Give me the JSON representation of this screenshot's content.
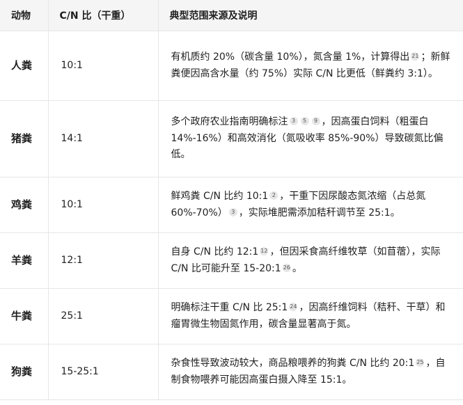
{
  "table": {
    "headers": [
      "动物",
      "C/N 比（干重）",
      "典型范围来源及说明"
    ],
    "rows": [
      {
        "animal": "人粪",
        "ratio": "10:1",
        "desc": [
          {
            "t": "有机质约 20%（碳含量 10%），氮含量 1%，计算得出"
          },
          {
            "c": "21"
          },
          {
            "t": "；新鲜粪便因高含水量（约 75%）实际 C/N 比更低（鲜粪约 3:1）。"
          }
        ]
      },
      {
        "animal": "猪粪",
        "ratio": "14:1",
        "desc": [
          {
            "t": "多个政府农业指南明确标注"
          },
          {
            "c": "3"
          },
          {
            "c": "5"
          },
          {
            "c": "9"
          },
          {
            "t": "，因高蛋白饲料（粗蛋白 14%-16%）和高效消化（氮吸收率 85%-90%）导致碳氮比偏低。"
          }
        ]
      },
      {
        "animal": "鸡粪",
        "ratio": "10:1",
        "desc": [
          {
            "t": "鲜鸡粪 C/N 比约 10:1"
          },
          {
            "c": "2"
          },
          {
            "t": "，干重下因尿酸态氮浓缩（占总氮 60%-70%）"
          },
          {
            "c": "3"
          },
          {
            "t": "，实际堆肥需添加秸秆调节至 25:1。"
          }
        ]
      },
      {
        "animal": "羊粪",
        "ratio": "12:1",
        "desc": [
          {
            "t": "自身 C/N 比约 12:1"
          },
          {
            "c": "12"
          },
          {
            "t": "，但因采食高纤维牧草（如苜蓿），实际 C/N 比可能升至 15-20:1"
          },
          {
            "c": "26"
          },
          {
            "t": "。"
          }
        ]
      },
      {
        "animal": "牛粪",
        "ratio": "25:1",
        "desc": [
          {
            "t": "明确标注干重 C/N 比 25:1"
          },
          {
            "c": "24"
          },
          {
            "t": "，因高纤维饲料（秸秆、干草）和瘤胃微生物固氮作用，碳含量显著高于氮。"
          }
        ]
      },
      {
        "animal": "狗粪",
        "ratio": "15-25:1",
        "desc": [
          {
            "t": "杂食性导致波动较大，商品粮喂养的狗粪 C/N 比约 20:1"
          },
          {
            "c": "25"
          },
          {
            "t": "，自制食物喂养可能因高蛋白摄入降至 15:1。"
          }
        ]
      }
    ]
  }
}
